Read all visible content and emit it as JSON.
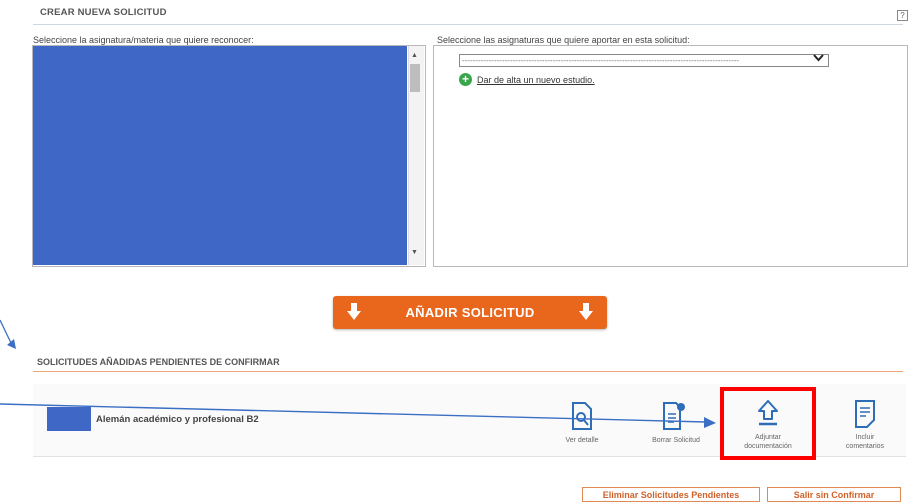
{
  "header": {
    "title": "CREAR NUEVA SOLICITUD",
    "help_label": "?"
  },
  "left_panel": {
    "label": "Seleccione la asignatura/materia que quiere reconocer:"
  },
  "right_panel": {
    "label": "Seleccione las asignaturas que quiere aportar en esta solicitud:",
    "select_value": "--------------------------------------------------------------------------------------------------------",
    "add_study_link": "Dar de alta un nuevo estudio."
  },
  "add_button": {
    "label": "AÑADIR SOLICITUD"
  },
  "pending": {
    "title": "SOLICITUDES AÑADIDAS PENDIENTES DE CONFIRMAR",
    "rows": [
      {
        "name": "Alemán académico y profesional B2"
      }
    ],
    "actions": {
      "view": "Ver detalle",
      "delete": "Borrar Solicitud",
      "attach_1": "Adjuntar",
      "attach_2": "documentación",
      "comments_1": "Incluir",
      "comments_2": "comentarios"
    }
  },
  "footer": {
    "delete_pending": "Eliminar Solicitudes Pendientes",
    "exit": "Salir sin Confirmar"
  },
  "colors": {
    "accent": "#e8671c",
    "selection": "#3f67c6",
    "highlight": "#ff0000",
    "icon_blue": "#2e6db8",
    "annotation_arrow": "#3b6fc4"
  }
}
